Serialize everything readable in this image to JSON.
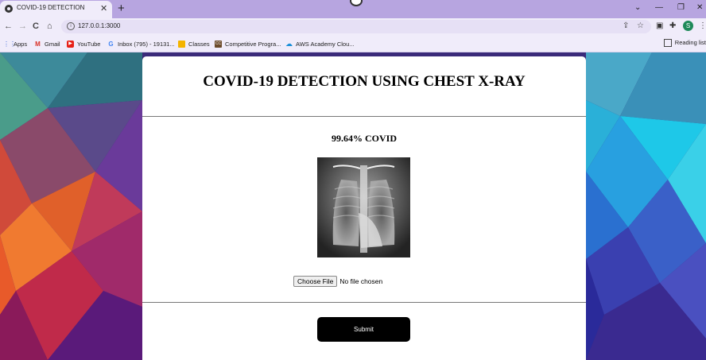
{
  "browser": {
    "tab": {
      "title": "COVID-19 DETECTION",
      "close": "✕"
    },
    "new_tab": "+",
    "window_controls": {
      "minimize": "—",
      "restore": "❐",
      "close": "✕",
      "tab_search": "⌄"
    },
    "nav": {
      "back": "←",
      "forward": "→",
      "reload": "C",
      "home": "⌂"
    },
    "url": "127.0.0.1:3000",
    "profile_initial": "S",
    "bookmarks": [
      {
        "label": "Apps",
        "icon": "apps-grid-icon"
      },
      {
        "label": "Gmail",
        "icon": "gmail-icon"
      },
      {
        "label": "YouTube",
        "icon": "youtube-icon"
      },
      {
        "label": "Inbox (795) - 19131...",
        "icon": "google-icon"
      },
      {
        "label": "Classes",
        "icon": "classroom-icon"
      },
      {
        "label": "Competitive Progra...",
        "icon": "cc-icon"
      },
      {
        "label": "AWS Academy Clou...",
        "icon": "cloud-icon"
      }
    ],
    "reading_list": "Reading list"
  },
  "page": {
    "heading": "COVID-19 DETECTION USING CHEST X-RAY",
    "result": "99.64% COVID",
    "file_input": {
      "button": "Choose File",
      "status": "No file chosen"
    },
    "submit": "Submit"
  },
  "colors": {
    "tab_strip": "#b7a5e0",
    "toolbar": "#f0ecfa",
    "submit_bg": "#000000",
    "card_bg": "#ffffff"
  }
}
